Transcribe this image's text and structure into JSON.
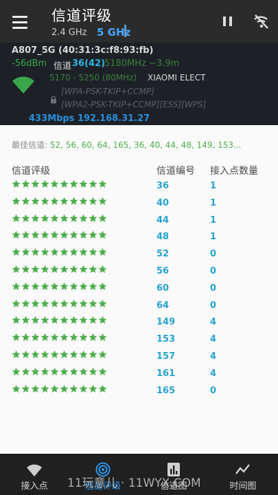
{
  "appbar": {
    "title": "信道评级",
    "band_24": "2.4 GHz",
    "band_5": "5 GHz",
    "pause_icon": "pause-icon",
    "wifi_off_icon": "wifi-off-icon"
  },
  "network": {
    "ssid": "A807_5G (40:31:3c:f8:93:fb)",
    "rssi": "-56dBm",
    "channel_label": "信道",
    "channel_value": "36(42)",
    "frequency": "5180MHz ~3.9m",
    "range": "5170 - 5250 (80MHz)",
    "vendor": "XIAOMI ELECT",
    "security_1": "[WPA-PSK-TKIP+CCMP]",
    "security_2": "[WPA2-PSK-TKIP+CCMP][ESS][WPS]",
    "speed_ip": "433Mbps 192.168.31.27"
  },
  "best": {
    "label": "最佳信道: ",
    "values": "52, 56, 60, 64, 165, 36, 40, 44, 48, 149, 153..."
  },
  "table": {
    "headers": [
      "信道评级",
      "信道编号",
      "接入点数量"
    ],
    "rows": [
      {
        "rating": 10,
        "channel": "36",
        "count": "1"
      },
      {
        "rating": 10,
        "channel": "40",
        "count": "1"
      },
      {
        "rating": 10,
        "channel": "44",
        "count": "1"
      },
      {
        "rating": 10,
        "channel": "48",
        "count": "1"
      },
      {
        "rating": 10,
        "channel": "52",
        "count": "0"
      },
      {
        "rating": 10,
        "channel": "56",
        "count": "0"
      },
      {
        "rating": 10,
        "channel": "60",
        "count": "0"
      },
      {
        "rating": 10,
        "channel": "64",
        "count": "0"
      },
      {
        "rating": 10,
        "channel": "149",
        "count": "4"
      },
      {
        "rating": 10,
        "channel": "153",
        "count": "4"
      },
      {
        "rating": 10,
        "channel": "157",
        "count": "4"
      },
      {
        "rating": 10,
        "channel": "161",
        "count": "4"
      },
      {
        "rating": 10,
        "channel": "165",
        "count": "0"
      }
    ]
  },
  "nav": {
    "items": [
      {
        "label": "接入点",
        "icon": "wifi-icon",
        "active": false
      },
      {
        "label": "信道评级",
        "icon": "channel-rating-icon",
        "active": true
      },
      {
        "label": "信道图",
        "icon": "channel-graph-icon",
        "active": false
      },
      {
        "label": "时间图",
        "icon": "time-graph-icon",
        "active": false
      }
    ]
  },
  "watermark": "11玩意儿 · 11WYX.COM",
  "colors": {
    "appbar": "#2b2b2b",
    "accent": "#2f9af0",
    "star": "#4cae4c",
    "channel_text": "#26a3d1"
  }
}
